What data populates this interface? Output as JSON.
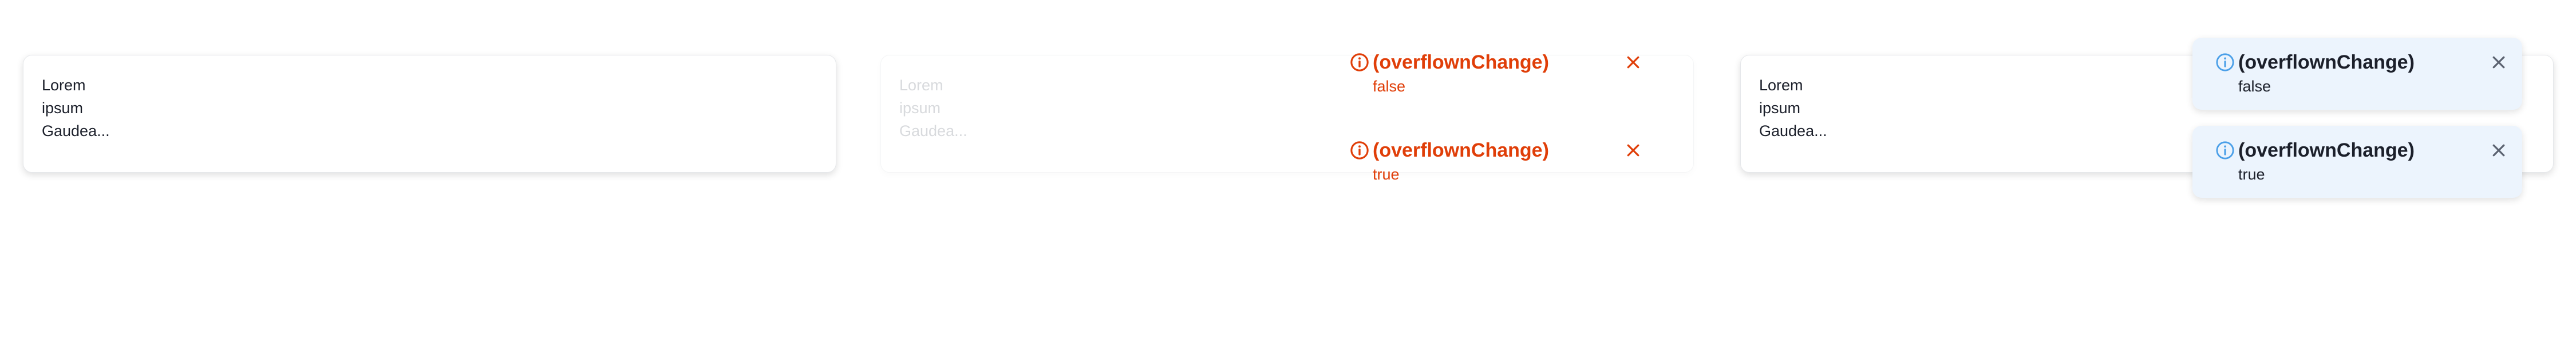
{
  "colors": {
    "error_accent": "#e03e08",
    "info_accent": "#4a9fe8",
    "info_background": "#ecf4fd",
    "text": "#1b1f2a",
    "close_info": "#5b6270"
  },
  "cards": [
    {
      "lines": [
        "Lorem",
        "ipsum",
        "Gaudea..."
      ],
      "state": "normal"
    },
    {
      "lines": [
        "Lorem",
        "ipsum",
        "Gaudea..."
      ],
      "state": "faded"
    },
    {
      "lines": [
        "Lorem",
        "ipsum",
        "Gaudea..."
      ],
      "state": "normal"
    }
  ],
  "toast_groups": [
    {
      "style": "plain",
      "icon": "info-circle-icon",
      "toasts": [
        {
          "title": "(overflownChange)",
          "body": "false",
          "close_icon": "close-icon"
        },
        {
          "title": "(overflownChange)",
          "body": "true",
          "close_icon": "close-icon"
        }
      ]
    },
    {
      "style": "info",
      "icon": "info-circle-icon",
      "toasts": [
        {
          "title": "(overflownChange)",
          "body": "false",
          "close_icon": "close-icon"
        },
        {
          "title": "(overflownChange)",
          "body": "true",
          "close_icon": "close-icon"
        }
      ]
    }
  ]
}
